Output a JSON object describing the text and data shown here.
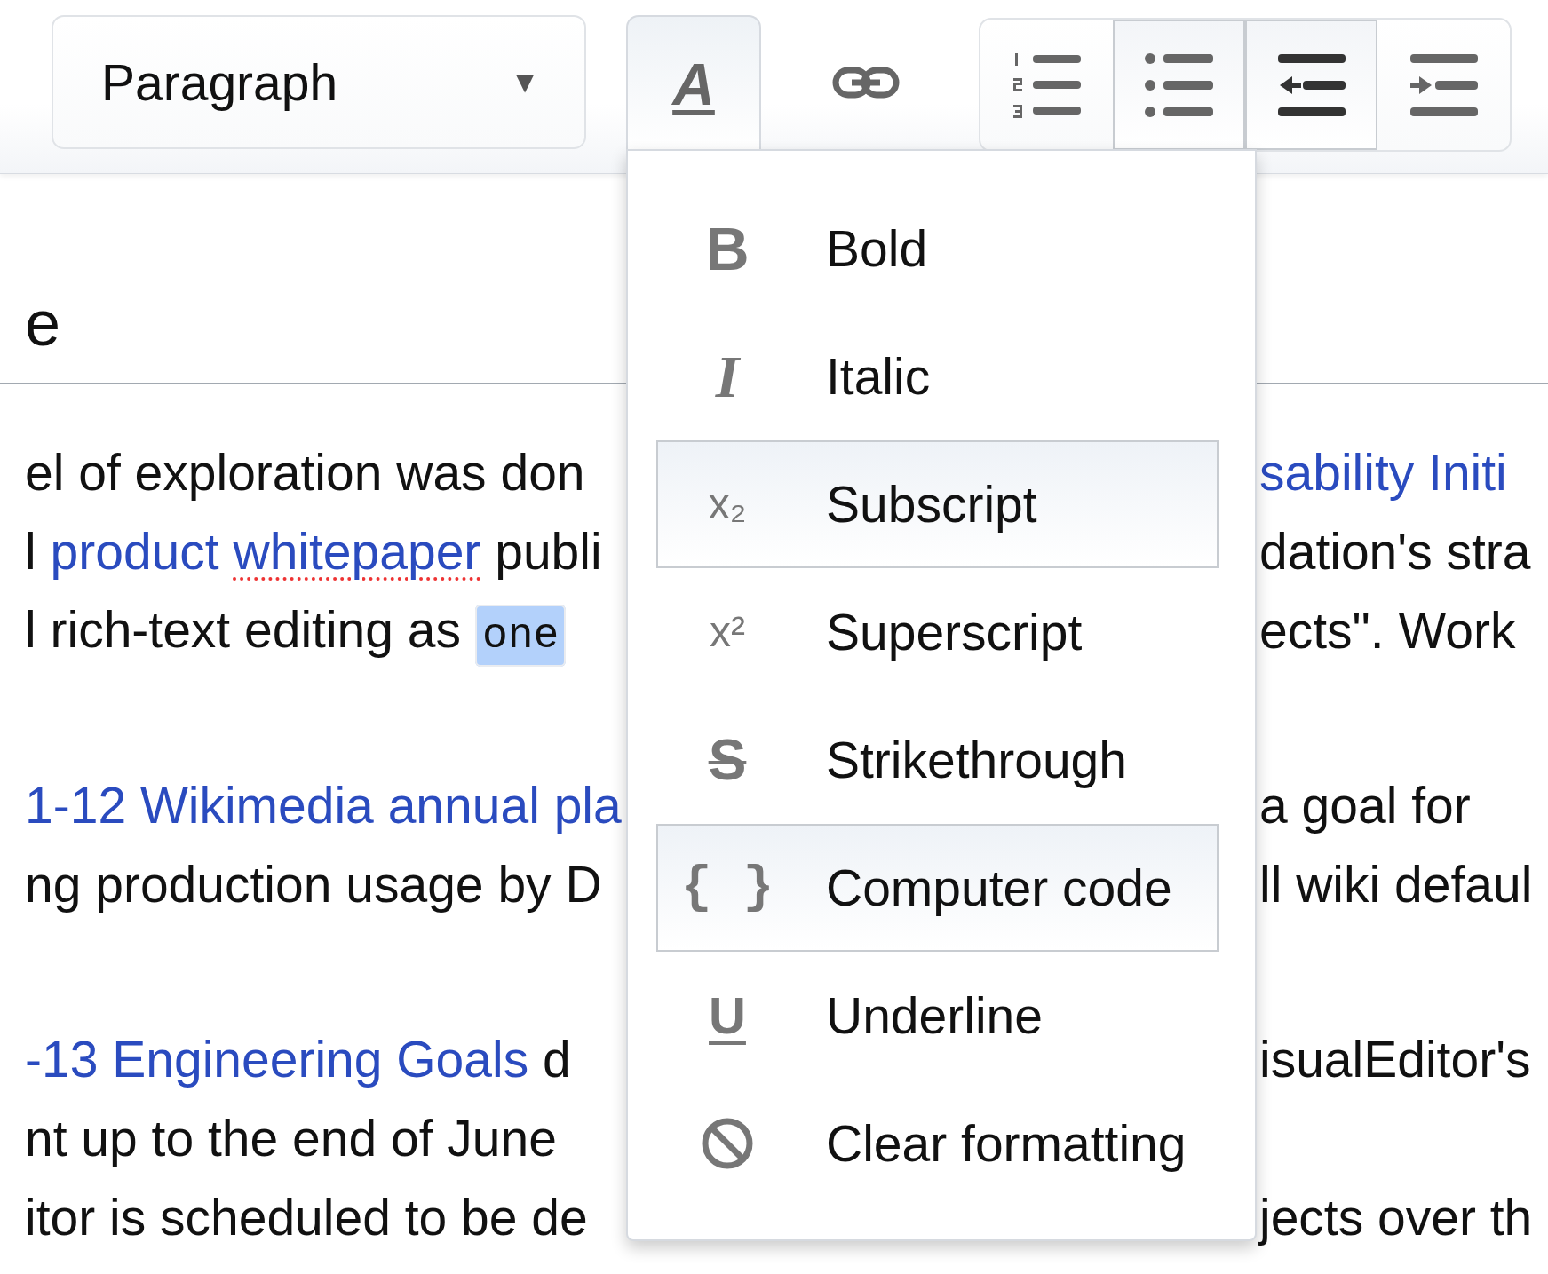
{
  "toolbar": {
    "format_dropdown": {
      "label": "Paragraph",
      "caret": "▼"
    },
    "style_button": {
      "icon": "A",
      "expanded": true
    },
    "list_buttons": [
      {
        "kind": "numbered",
        "active": false
      },
      {
        "kind": "bullet",
        "active": true
      },
      {
        "kind": "outdent",
        "active": true
      },
      {
        "kind": "indent",
        "active": false
      }
    ]
  },
  "heading": {
    "text": "e"
  },
  "paragraphs": [
    {
      "rows": [
        {
          "left": [
            {
              "kind": "text",
              "text": "el of exploration was don",
              "misspelled": false,
              "selected": false
            }
          ],
          "right": [
            {
              "kind": "link",
              "text": "sability Initi",
              "misspelled": false,
              "selected": false
            }
          ]
        },
        {
          "left": [
            {
              "kind": "text",
              "text": "l",
              "misspelled": false,
              "selected": false
            },
            {
              "kind": "link",
              "text": "product",
              "misspelled": false,
              "selected": false
            },
            {
              "kind": "link",
              "text": "whitepaper",
              "misspelled": true,
              "selected": false
            },
            {
              "kind": "text",
              "text": "publi",
              "misspelled": false,
              "selected": false
            }
          ],
          "right": [
            {
              "kind": "text",
              "text": "dation's stra",
              "misspelled": false,
              "selected": false
            }
          ]
        },
        {
          "left": [
            {
              "kind": "text",
              "text": "l rich-text editing as",
              "misspelled": false,
              "selected": false
            },
            {
              "kind": "code",
              "text": "one",
              "misspelled": false,
              "selected": true
            }
          ],
          "right": [
            {
              "kind": "text",
              "text": "ects\". Work",
              "misspelled": false,
              "selected": false
            }
          ]
        }
      ]
    },
    {
      "rows": [
        {
          "left": [
            {
              "kind": "link",
              "text": "1-12 Wikimedia annual pla",
              "misspelled": false,
              "selected": false
            }
          ],
          "right": [
            {
              "kind": "text",
              "text": "a goal for",
              "misspelled": false,
              "selected": false
            }
          ]
        },
        {
          "left": [
            {
              "kind": "text",
              "text": "ng production usage by D",
              "misspelled": false,
              "selected": false
            }
          ],
          "right": [
            {
              "kind": "text",
              "text": "ll wiki defaul",
              "misspelled": false,
              "selected": false
            }
          ]
        }
      ]
    },
    {
      "rows": [
        {
          "left": [
            {
              "kind": "link",
              "text": "-13 Engineering Goals",
              "misspelled": false,
              "selected": false
            },
            {
              "kind": "text",
              "text": "d",
              "misspelled": false,
              "selected": false
            }
          ],
          "right": [
            {
              "kind": "text",
              "text": "isualEditor's",
              "misspelled": false,
              "selected": false
            }
          ]
        },
        {
          "left": [
            {
              "kind": "text",
              "text": "nt up to the end of June",
              "misspelled": false,
              "selected": false
            }
          ]
        },
        {
          "left": [
            {
              "kind": "text",
              "text": "itor is scheduled to be de",
              "misspelled": false,
              "selected": false
            }
          ],
          "right": [
            {
              "kind": "text",
              "text": "jects over th",
              "misspelled": false,
              "selected": false
            }
          ]
        }
      ]
    }
  ],
  "style_menu": {
    "items": [
      {
        "kind": "bold",
        "icon": "B",
        "label": "Bold",
        "highlighted": false
      },
      {
        "kind": "italic",
        "icon": "I",
        "label": "Italic",
        "highlighted": false
      },
      {
        "kind": "subscript",
        "icon": "x₂",
        "label": "Subscript",
        "highlighted": true
      },
      {
        "kind": "superscript",
        "icon": "x²",
        "label": "Superscript",
        "highlighted": false
      },
      {
        "kind": "strikethrough",
        "icon": "S",
        "label": "Strikethrough",
        "highlighted": false
      },
      {
        "kind": "code",
        "icon": "{ }",
        "label": "Computer code",
        "highlighted": true
      },
      {
        "kind": "underline",
        "icon": "U",
        "label": "Underline",
        "highlighted": false
      },
      {
        "kind": "clear",
        "label": "Clear formatting",
        "highlighted": false
      }
    ]
  }
}
